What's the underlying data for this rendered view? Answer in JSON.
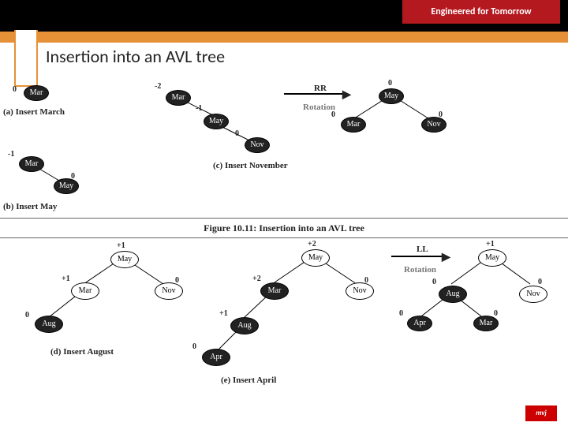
{
  "header": {
    "tagline": "Engineered for Tomorrow"
  },
  "title": "Insertion into an AVL tree",
  "figure_caption": "Figure 10.11: Insertion into an AVL tree",
  "rotations": {
    "rr": "RR",
    "ll": "LL",
    "rot_label": "Rotation"
  },
  "panels": {
    "a": {
      "label": "(a) Insert March"
    },
    "b": {
      "label": "(b) Insert May"
    },
    "c": {
      "label": "(c) Insert November"
    },
    "d": {
      "label": "(d) Insert August"
    },
    "e": {
      "label": "(e) Insert April"
    }
  },
  "nodes": {
    "mar": "Mar",
    "may": "May",
    "nov": "Nov",
    "aug": "Aug",
    "apr": "Apr"
  },
  "bf": {
    "zero": "0",
    "p1": "+1",
    "m1": "-1",
    "m2": "-2",
    "p2": "+2"
  },
  "logo": "mvj"
}
